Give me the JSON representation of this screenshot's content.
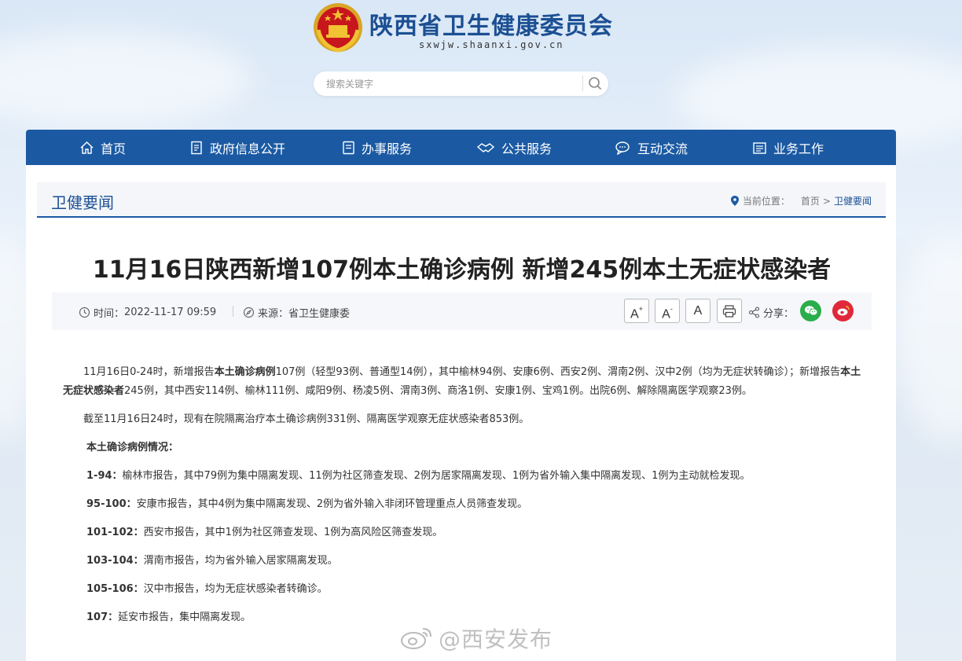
{
  "site": {
    "title": "陕西省卫生健康委员会",
    "domain": "sxwjw.shaanxi.gov.cn"
  },
  "search": {
    "placeholder": "搜索关键字"
  },
  "nav": {
    "items": [
      {
        "label": "首页",
        "icon": "home-icon"
      },
      {
        "label": "政府信息公开",
        "icon": "document-list-icon"
      },
      {
        "label": "办事服务",
        "icon": "service-doc-icon"
      },
      {
        "label": "公共服务",
        "icon": "handshake-icon"
      },
      {
        "label": "互动交流",
        "icon": "chat-bubble-icon"
      },
      {
        "label": "业务工作",
        "icon": "briefcase-icon"
      }
    ]
  },
  "section": {
    "title": "卫健要闻"
  },
  "breadcrumb": {
    "prefix": "当前位置：",
    "home": "首页",
    "separator": ">",
    "current": "卫健要闻"
  },
  "article": {
    "title": "11月16日陕西新增107例本土确诊病例 新增245例本土无症状感染者",
    "time_label": "时间：",
    "time_value": "2022-11-17 09:59",
    "source_label": "来源：",
    "source_value": "省卫生健康委",
    "font_large": "A",
    "font_small": "A",
    "font_normal": "A",
    "share_label": "分享：",
    "p1_a": "11月16日0-24时，新增报告",
    "p1_b": "本土确诊病例",
    "p1_c": "107例（轻型93例、普通型14例），其中榆林94例、安康6例、西安2例、渭南2例、汉中2例（均为无症状转确诊）；新增报告",
    "p1_d": "本土无症状感染者",
    "p1_e": "245例，其中西安114例、榆林111例、咸阳9例、杨凌5例、渭南3例、商洛1例、安康1例、宝鸡1例。出院6例、解除隔离医学观察23例。",
    "p2": "截至11月16日24时，现有在院隔离治疗本土确诊病例331例、隔离医学观察无症状感染者853例。",
    "cases_heading": "本土确诊病例情况：",
    "cases": [
      {
        "range": "1-94：",
        "text": "榆林市报告，其中79例为集中隔离发现、11例为社区筛查发现、2例为居家隔离发现、1例为省外输入集中隔离发现、1例为主动就检发现。"
      },
      {
        "range": "95-100：",
        "text": "安康市报告，其中4例为集中隔离发现、2例为省外输入非闭环管理重点人员筛查发现。"
      },
      {
        "range": "101-102：",
        "text": "西安市报告，其中1例为社区筛查发现、1例为高风险区筛查发现。"
      },
      {
        "range": "103-104：",
        "text": "渭南市报告，均为省外输入居家隔离发现。"
      },
      {
        "range": "105-106：",
        "text": "汉中市报告，均为无症状感染者转确诊。"
      },
      {
        "range": "107：",
        "text": "延安市报告，集中隔离发现。"
      }
    ]
  },
  "watermark": {
    "text": "@西安发布"
  },
  "colors": {
    "brand_blue": "#1b5aa3",
    "title_blue": "#1c4f93",
    "wechat_green": "#2aae4b",
    "weibo_red": "#e0283a"
  }
}
